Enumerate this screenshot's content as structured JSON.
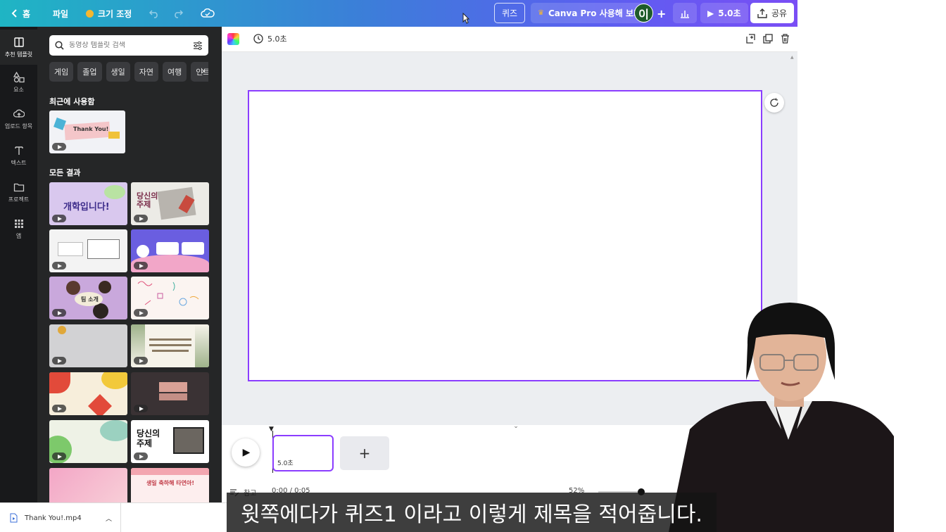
{
  "topbar": {
    "home_label": "홈",
    "file_label": "파일",
    "resize_label": "크기 조정",
    "quiz_label": "퀴즈",
    "pro_label": "Canva Pro 사용해 보기",
    "avatar_initial": "이",
    "play_duration": "5.0초",
    "share_label": "공유"
  },
  "rail": {
    "items": [
      {
        "label": "추천 템플릿",
        "icon": "template-icon"
      },
      {
        "label": "요소",
        "icon": "elements-icon"
      },
      {
        "label": "업로드 항목",
        "icon": "upload-icon"
      },
      {
        "label": "텍스트",
        "icon": "text-icon"
      },
      {
        "label": "프로젝트",
        "icon": "folder-icon"
      },
      {
        "label": "앱",
        "icon": "apps-icon"
      }
    ]
  },
  "panel": {
    "search_placeholder": "동영상 템플릿 검색",
    "chips": [
      "게임",
      "졸업",
      "생일",
      "자연",
      "여행",
      "인트로"
    ],
    "recent_title": "최근에 사용함",
    "recent_thumb_text": "Thank You!",
    "all_results_title": "모든 결과",
    "thumb_texts": {
      "t1": "개학입니다!",
      "t2": "당신의 주제",
      "t5": "팀 소개",
      "t12": "당신의 주제",
      "t14": "생일 축하해 타연아!"
    }
  },
  "editor": {
    "duration_label": "5.0초",
    "clip_duration": "5.0초",
    "notes_label": "참고",
    "time_readout": "0:00 / 0:05",
    "zoom_label": "52%"
  },
  "download": {
    "filename": "Thank You!.mp4"
  },
  "subtitle": {
    "text": "윗쪽에다가 퀴즈1 이라고 이렇게 제목을 적어줍니다."
  },
  "colors": {
    "accent": "#8b3dff",
    "panel_bg": "#252627",
    "rail_bg": "#18191b"
  }
}
